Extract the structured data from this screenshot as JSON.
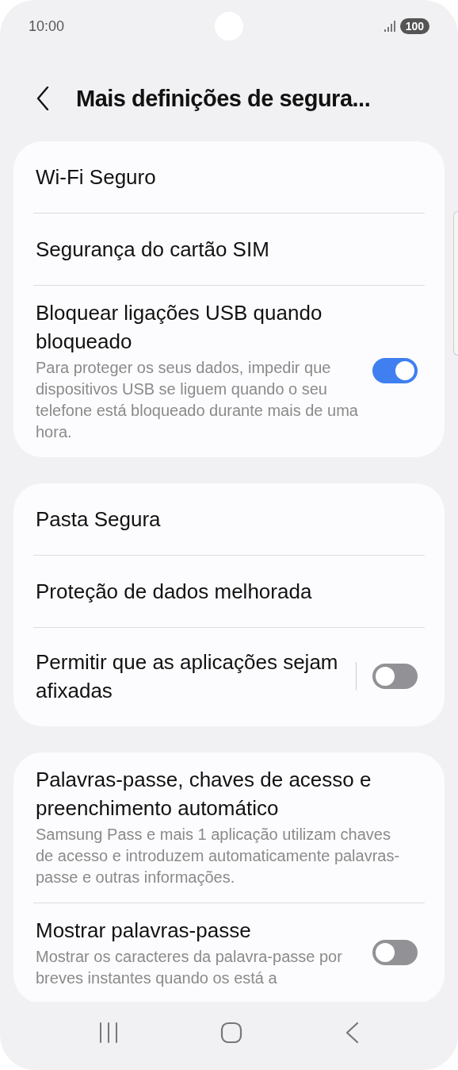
{
  "status_bar": {
    "time": "10:00",
    "battery": "100"
  },
  "header": {
    "title": "Mais definições de segura..."
  },
  "cards": [
    {
      "items": [
        {
          "kind": "link",
          "title": "Wi-Fi Seguro"
        },
        {
          "kind": "link",
          "title": "Segurança do cartão SIM"
        },
        {
          "kind": "switch",
          "title": "Bloquear ligações USB quando bloqueado",
          "description": "Para proteger os seus dados, impedir que dispositivos USB se liguem quando o seu telefone está bloqueado durante mais de uma hora.",
          "on": true,
          "separated": false
        }
      ]
    },
    {
      "items": [
        {
          "kind": "link",
          "title": "Pasta Segura"
        },
        {
          "kind": "link",
          "title": "Proteção de dados melhorada"
        },
        {
          "kind": "switch",
          "title": "Permitir que as aplicações sejam afixadas",
          "on": false,
          "separated": true
        }
      ]
    },
    {
      "items": [
        {
          "kind": "link",
          "title": "Palavras-passe, chaves de acesso e preenchimento automático",
          "description": "Samsung Pass e mais 1 aplicação utilizam chaves de acesso e introduzem automaticamente palavras-passe e outras informações."
        },
        {
          "kind": "switch",
          "title": "Mostrar palavras-passe",
          "description": "Mostrar os caracteres da palavra-passe por breves instantes quando os está a",
          "on": false,
          "separated": false
        }
      ]
    }
  ]
}
